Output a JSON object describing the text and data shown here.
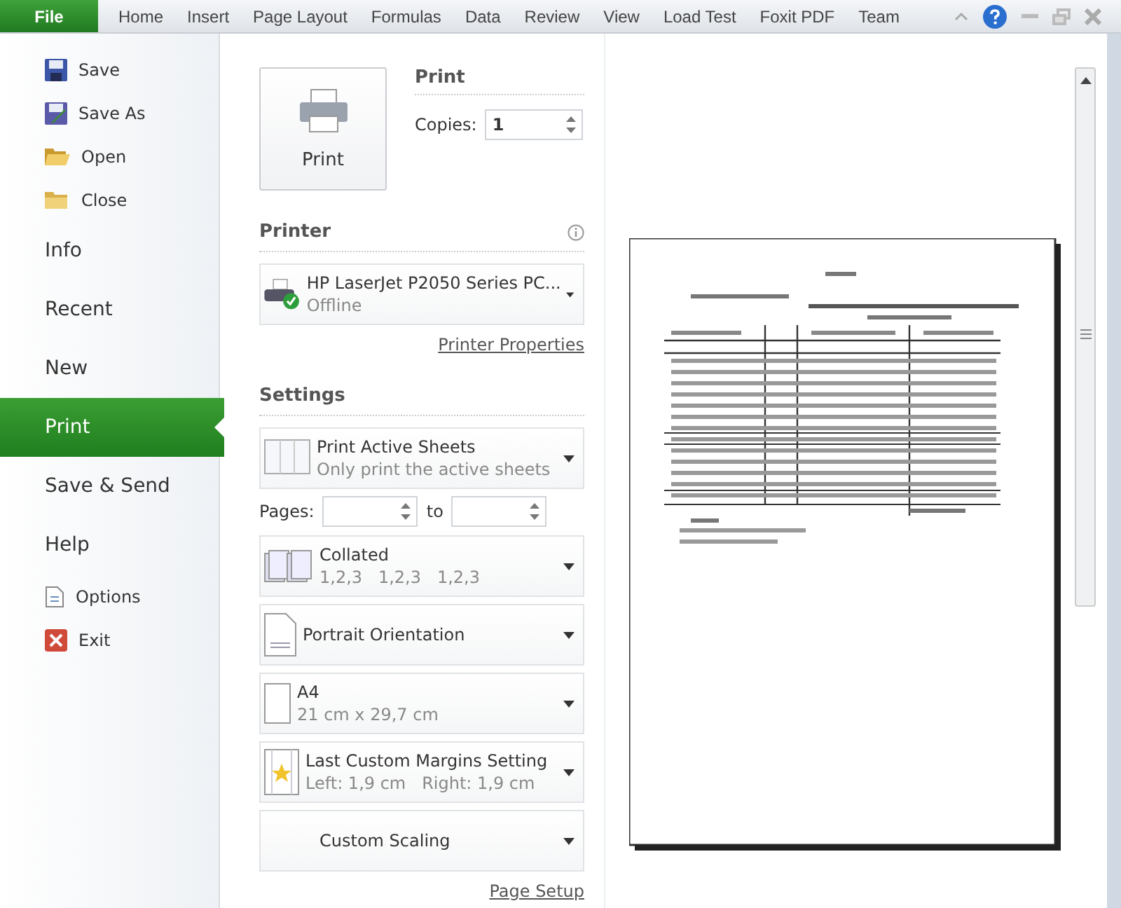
{
  "ribbon_tabs": [
    {
      "label": "File",
      "selected": true
    },
    {
      "label": "Home",
      "selected": false
    },
    {
      "label": "Insert",
      "selected": false
    },
    {
      "label": "Page Layout",
      "selected": false
    },
    {
      "label": "Formulas",
      "selected": false
    },
    {
      "label": "Data",
      "selected": false
    },
    {
      "label": "Review",
      "selected": false
    },
    {
      "label": "View",
      "selected": false
    },
    {
      "label": "Load Test",
      "selected": false
    },
    {
      "label": "Foxit PDF",
      "selected": false
    },
    {
      "label": "Team",
      "selected": false
    }
  ],
  "backstage_nav": [
    {
      "label": "Save",
      "kind": "command",
      "selected": false
    },
    {
      "label": "Save As",
      "kind": "command",
      "selected": false
    },
    {
      "label": "Open",
      "kind": "command",
      "selected": false
    },
    {
      "label": "Close",
      "kind": "command",
      "selected": false
    },
    {
      "label": "Info",
      "kind": "tab",
      "selected": false
    },
    {
      "label": "Recent",
      "kind": "tab",
      "selected": false
    },
    {
      "label": "New",
      "kind": "tab",
      "selected": false
    },
    {
      "label": "Print",
      "kind": "tab",
      "selected": true
    },
    {
      "label": "Save & Send",
      "kind": "tab",
      "selected": false
    },
    {
      "label": "Help",
      "kind": "tab",
      "selected": false
    },
    {
      "label": "Options",
      "kind": "command",
      "selected": false
    },
    {
      "label": "Exit",
      "kind": "command",
      "selected": false
    }
  ],
  "print": {
    "button": "Print",
    "heading": "Print",
    "copies_label": "Copies:",
    "copies_value": "1"
  },
  "printer": {
    "heading": "Printer",
    "name": "HP LaserJet P2050 Series PC...",
    "status": "Offline",
    "properties_link": "Printer Properties"
  },
  "settings": {
    "heading": "Settings",
    "dropdowns": [
      {
        "title": "Print Active Sheets",
        "subtitle": "Only print the active sheets"
      },
      {
        "title": "Collated",
        "subtitle": "1,2,3   1,2,3   1,2,3"
      },
      {
        "title": "Portrait Orientation"
      },
      {
        "title": "A4",
        "subtitle": "21 cm x 29,7 cm"
      },
      {
        "title": "Last Custom Margins Setting",
        "subtitle": "Left: 1,9 cm   Right: 1,9 cm"
      },
      {
        "title": "Custom Scaling"
      }
    ],
    "pages_label": "Pages:",
    "to_label": "to",
    "page_setup_link": "Page Setup"
  }
}
